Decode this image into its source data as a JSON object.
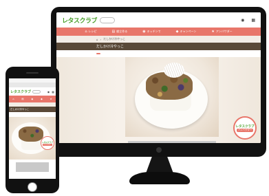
{
  "site": {
    "logo_text": "レタスクラブ",
    "logo_sub": "",
    "badge_line1": "",
    "badge_brand": "レタスクラブ",
    "badge_tag": "アンバサダー"
  },
  "desktop": {
    "header_icons": [
      {
        "icon": "login-icon",
        "glyph": "◉",
        "label": ""
      },
      {
        "icon": "register-icon",
        "glyph": "▦",
        "label": ""
      }
    ],
    "nav": [
      {
        "icon": "home-icon",
        "glyph": "⌂",
        "label": "レシピ"
      },
      {
        "icon": "book-icon",
        "glyph": "▤",
        "label": "献立作る"
      },
      {
        "icon": "pot-icon",
        "glyph": "◉",
        "label": "キッチンで"
      },
      {
        "icon": "gift-icon",
        "glyph": "◆",
        "label": "キャンペーン"
      },
      {
        "icon": "star-icon",
        "glyph": "★",
        "label": "アンバサダー"
      }
    ],
    "breadcrumb": [
      "⌂",
      "›",
      "だしかけ冷やっこ"
    ],
    "title": "だしかけ冷やっこ",
    "tag": "",
    "tools": [
      "",
      "",
      ""
    ]
  },
  "phone": {
    "status_left": "",
    "status_time": "",
    "status_right": "",
    "url": "",
    "title": "だしかけ冷やっこ",
    "breadcrumb": "",
    "tag": "",
    "tools": [
      "",
      ""
    ],
    "nav": [
      {
        "icon": "home-icon",
        "glyph": "⌂",
        "label": ""
      },
      {
        "icon": "book-icon",
        "glyph": "▤",
        "label": ""
      },
      {
        "icon": "pot-icon",
        "glyph": "◉",
        "label": ""
      },
      {
        "icon": "gift-icon",
        "glyph": "◆",
        "label": ""
      },
      {
        "icon": "star-icon",
        "glyph": "★",
        "label": ""
      }
    ]
  }
}
